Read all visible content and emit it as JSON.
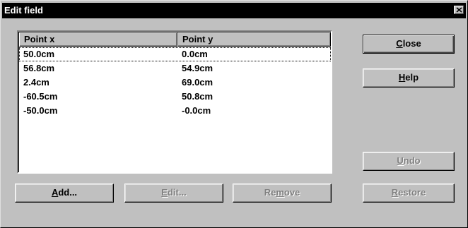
{
  "window": {
    "title": "Edit field",
    "close_glyph": "×"
  },
  "list": {
    "columns": [
      "Point x",
      "Point y"
    ],
    "rows": [
      {
        "x": "50.0cm",
        "y": "0.0cm"
      },
      {
        "x": "56.8cm",
        "y": "54.9cm"
      },
      {
        "x": "2.4cm",
        "y": "69.0cm"
      },
      {
        "x": "-60.5cm",
        "y": "50.8cm"
      },
      {
        "x": "-50.0cm",
        "y": "-0.0cm"
      }
    ]
  },
  "buttons": {
    "close": {
      "pre": "",
      "key": "C",
      "post": "lose"
    },
    "help": {
      "pre": "",
      "key": "H",
      "post": "elp"
    },
    "undo": {
      "pre": "",
      "key": "U",
      "post": "ndo"
    },
    "restore": {
      "pre": "",
      "key": "R",
      "post": "estore"
    },
    "add": {
      "pre": "",
      "key": "A",
      "post": "dd..."
    },
    "edit": {
      "pre": "",
      "key": "E",
      "post": "dit..."
    },
    "remove": {
      "pre": "Re",
      "key": "m",
      "post": "ove"
    }
  }
}
